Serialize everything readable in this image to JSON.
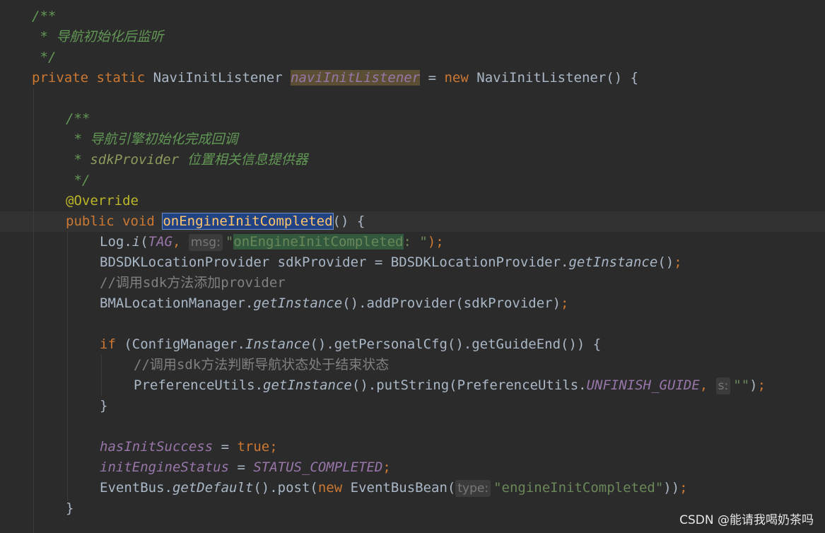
{
  "code": {
    "l1": "/**",
    "l2": " * 导航初始化后监听",
    "l3": " */",
    "l4": {
      "private": "private",
      "static": "static",
      "type": "NaviInitListener",
      "field": "naviInitListener",
      "eq": " = ",
      "new": "new",
      "ctor": "NaviInitListener() {"
    },
    "l6": "/**",
    "l7": " * 导航引擎初始化完成回调",
    "l8": {
      "star": " * ",
      "param": "sdkProvider",
      "desc": " 位置相关信息提供器"
    },
    "l9": " */",
    "l10": "@Override",
    "l11": {
      "public": "public",
      "void": "void",
      "method": "onEngineInitCompleted",
      "tail": "() {"
    },
    "l12": {
      "log": "Log.",
      "i": "i",
      "open": "(",
      "tag": "TAG",
      "comma": ", ",
      "hint": "msg:",
      "q": "\"",
      "str": "onEngineInitCompleted",
      "strtail": ": \"",
      "close": ");"
    },
    "l13": {
      "a": "BDSDKLocationProvider sdkProvider = BDSDKLocationProvider.",
      "m": "getInstance",
      "b": "()",
      "semi": ";"
    },
    "l14": "//调用sdk方法添加provider",
    "l15": {
      "a": "BMALocationManager.",
      "m": "getInstance",
      "b": "().addProvider(sdkProvider)",
      "semi": ";"
    },
    "l17": {
      "if": "if",
      "a": " (ConfigManager.",
      "m": "Instance",
      "b": "().getPersonalCfg().getGuideEnd()) {"
    },
    "l18": "//调用sdk方法判断导航状态处于结束状态",
    "l19": {
      "a": "PreferenceUtils.",
      "m": "getInstance",
      "b": "().putString(PreferenceUtils.",
      "const": "UNFINISH_GUIDE",
      "comma": ", ",
      "hint": "s:",
      "str": "\"\"",
      "close": ")",
      "semi": ";"
    },
    "l20": "}",
    "l22": {
      "field": "hasInitSuccess",
      "eq": " = ",
      "val": "true",
      "semi": ";"
    },
    "l23": {
      "field": "initEngineStatus",
      "eq": " = ",
      "const": "STATUS_COMPLETED",
      "semi": ";"
    },
    "l24": {
      "a": "EventBus.",
      "m": "getDefault",
      "b": "().post(",
      "new": "new",
      "cls": " EventBusBean(",
      "hint": "type:",
      "str": "\"engineInitCompleted\"",
      "close": "))",
      "semi": ";"
    },
    "l25": "}"
  },
  "watermark": "CSDN @能请我喝奶茶吗"
}
